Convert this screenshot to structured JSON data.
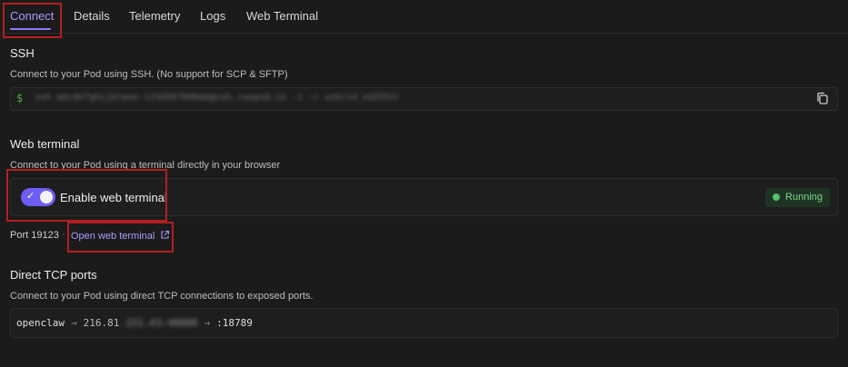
{
  "tabs": [
    "Connect",
    "Details",
    "Telemetry",
    "Logs",
    "Web Terminal"
  ],
  "ssh": {
    "title": "SSH",
    "description": "Connect to your Pod using SSH. (No support for SCP & SFTP)",
    "prompt": "$",
    "command_redacted": "ssh abcdefghijklmno-1234567890ab@ssh.runpod.io -i ~/.ssh/id_ed25519"
  },
  "web_terminal": {
    "title": "Web terminal",
    "description": "Connect to your Pod using a terminal directly in your browser",
    "toggle_label": "Enable web terminal",
    "status": "Running",
    "port": "Port 19123",
    "separator": "·",
    "open_link": "Open web terminal"
  },
  "tcp": {
    "title": "Direct TCP ports",
    "description": "Connect to your Pod using direct TCP connections to exposed ports.",
    "service": "openclaw",
    "ip_prefix": "216.81",
    "ip_redacted": ".151.43:40000",
    "port": ":18789"
  },
  "colors": {
    "background": "#1b1b1b",
    "accent": "#8b7bff",
    "highlight": "#b21f1f",
    "running": "#4fc46a"
  }
}
